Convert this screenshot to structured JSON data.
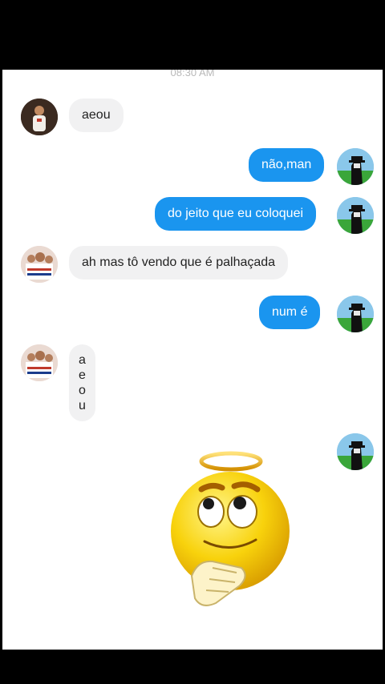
{
  "timestamp": "08:30 AM",
  "messages": {
    "m1": "aeou",
    "m2": "não,man",
    "m3": "do jeito que eu coloquei",
    "m4": "ah mas tô vendo que é palhaçada",
    "m5": "num é",
    "m6": [
      "a",
      "e",
      "o",
      "u"
    ]
  },
  "sticker_icon": "angel-emoji-sticker-icon",
  "colors": {
    "outgoing_bubble": "#1a95ef",
    "incoming_bubble": "#f1f1f2",
    "frame": "#000000"
  }
}
